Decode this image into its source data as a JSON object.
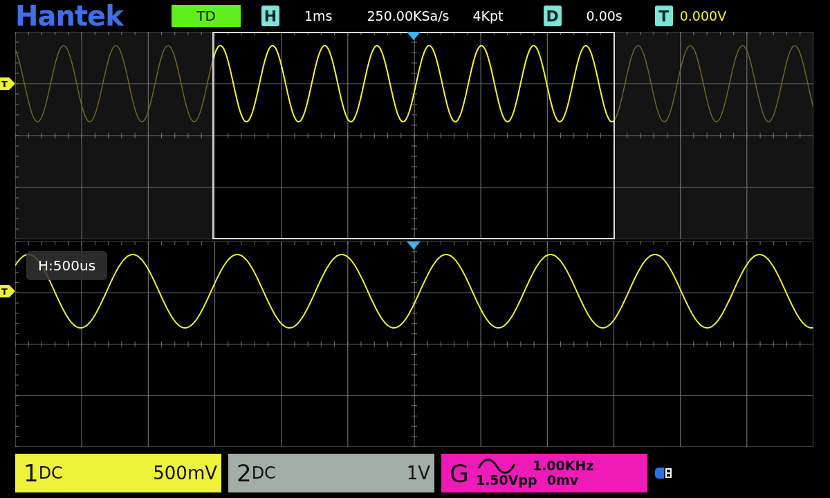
{
  "logo": "Hantek",
  "mode": "TD",
  "timebase": {
    "badge": "H",
    "value": "1ms"
  },
  "sample_rate": "250.00KSa/s",
  "memory_depth": "4Kpt",
  "delay": {
    "badge": "D",
    "value": "0.00s"
  },
  "trigger": {
    "badge": "T",
    "value": "0.000V"
  },
  "main_panel": {
    "trigger_marker": "T"
  },
  "zoom_panel": {
    "trigger_marker": "T",
    "label": "H:500us"
  },
  "channels": [
    {
      "number": "1",
      "coupling": "DC",
      "scale": "500mV",
      "color": "#eef23a"
    },
    {
      "number": "2",
      "coupling": "DC",
      "scale": "1V",
      "color": "#a3aea6"
    }
  ],
  "generator": {
    "letter": "G",
    "frequency": "1.00KHz",
    "amplitude": "1.50Vpp",
    "offset": "0mv"
  }
}
